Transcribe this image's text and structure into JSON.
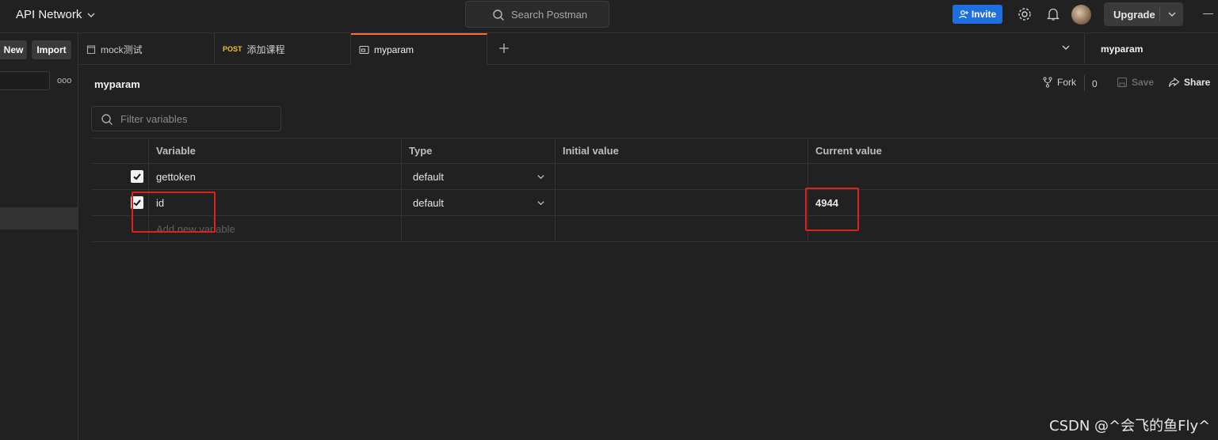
{
  "topbar": {
    "workspace": "API Network",
    "search_placeholder": "Search Postman",
    "invite_label": "Invite",
    "upgrade_label": "Upgrade",
    "icons": [
      "settings-icon",
      "bell-icon",
      "avatar"
    ]
  },
  "sidebar": {
    "new_label": "New",
    "import_label": "Import",
    "more_label": "ooo"
  },
  "tabs": [
    {
      "label": "mock测试",
      "icon": "collection-icon",
      "method": ""
    },
    {
      "label": "添加课程",
      "icon": "",
      "method": "POST"
    },
    {
      "label": "myparam",
      "icon": "environment-icon",
      "method": "",
      "active": true
    }
  ],
  "env_selector": "myparam",
  "main": {
    "title": "myparam",
    "fork_label": "Fork",
    "fork_count": "0",
    "save_label": "Save",
    "share_label": "Share",
    "filter_placeholder": "Filter variables"
  },
  "table": {
    "headers": {
      "variable": "Variable",
      "type": "Type",
      "initial": "Initial value",
      "current": "Current value"
    },
    "rows": [
      {
        "checked": true,
        "variable": "gettoken",
        "type": "default",
        "initial": "",
        "current": ""
      },
      {
        "checked": true,
        "variable": "id",
        "type": "default",
        "initial": "",
        "current": "4944"
      }
    ],
    "new_row_placeholder": "Add new variable"
  },
  "watermark": "CSDN @^会飞的鱼Fly^",
  "colors": {
    "accent": "#ff6c37",
    "invite": "#1f6fe0",
    "highlight": "#e0201b",
    "post": "#f4c020"
  }
}
